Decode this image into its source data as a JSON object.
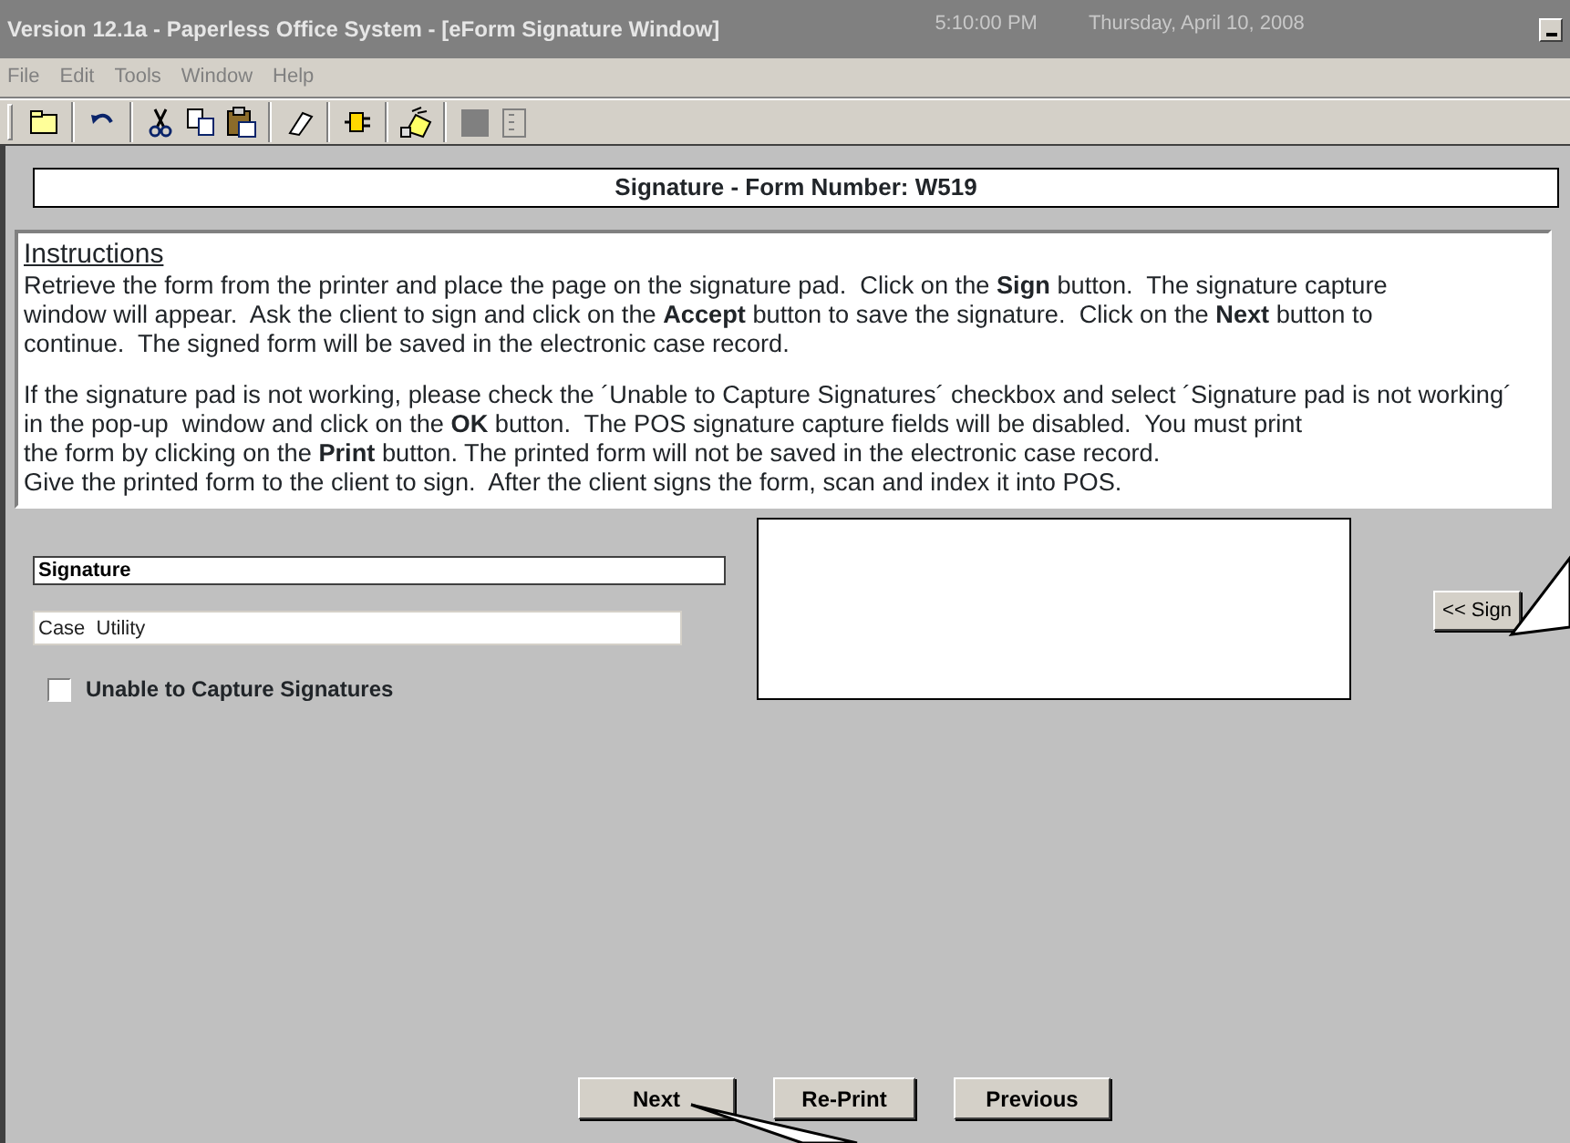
{
  "window": {
    "title": "Version 12.1a - Paperless Office System - [eForm Signature Window]",
    "time": "5:10:00 PM",
    "date": "Thursday, April 10, 2008"
  },
  "menu": [
    "File",
    "Edit",
    "Tools",
    "Window",
    "Help"
  ],
  "toolbar": [
    {
      "kind": "folder"
    },
    {
      "kind": "sep"
    },
    {
      "kind": "undo"
    },
    {
      "kind": "sep"
    },
    {
      "kind": "cut"
    },
    {
      "kind": "copy"
    },
    {
      "kind": "paste"
    },
    {
      "kind": "sep"
    },
    {
      "kind": "eraser"
    },
    {
      "kind": "sep"
    },
    {
      "kind": "plug"
    },
    {
      "kind": "sep"
    },
    {
      "kind": "sign"
    },
    {
      "kind": "sep"
    },
    {
      "kind": "square"
    },
    {
      "kind": "doc"
    }
  ],
  "form_header": "Signature - Form Number: W519",
  "instructions": {
    "heading": "Instructions",
    "paragraphs": [
      "Retrieve the form from the printer and place the page on the signature pad.  Click on the **Sign** button.  The signature capture\nwindow will appear.  Ask the client to sign and click on the **Accept** button to save the signature.  Click on the **Next** button to\ncontinue.  The signed form will be saved in the electronic case record.",
      "If the signature pad is not working, please check the ´Unable to Capture Signatures´ checkbox and select ´Signature pad is not working´\nin the pop-up  window and click on the **OK** button.  The POS signature capture fields will be disabled.  You must print\nthe form by clicking on the **Print** button. The printed form will not be saved in the electronic case record.\nGive the printed form to the client to sign.  After the client signs the form, scan and index it into POS."
    ]
  },
  "signature_field": {
    "value": "Signature"
  },
  "case_field": {
    "value": "Case  Utility"
  },
  "unable_checkbox": {
    "label": "Unable to Capture Signatures",
    "checked": false
  },
  "sign_button": "<< Sign",
  "buttons": [
    "Next",
    "Re-Print",
    "Previous"
  ]
}
